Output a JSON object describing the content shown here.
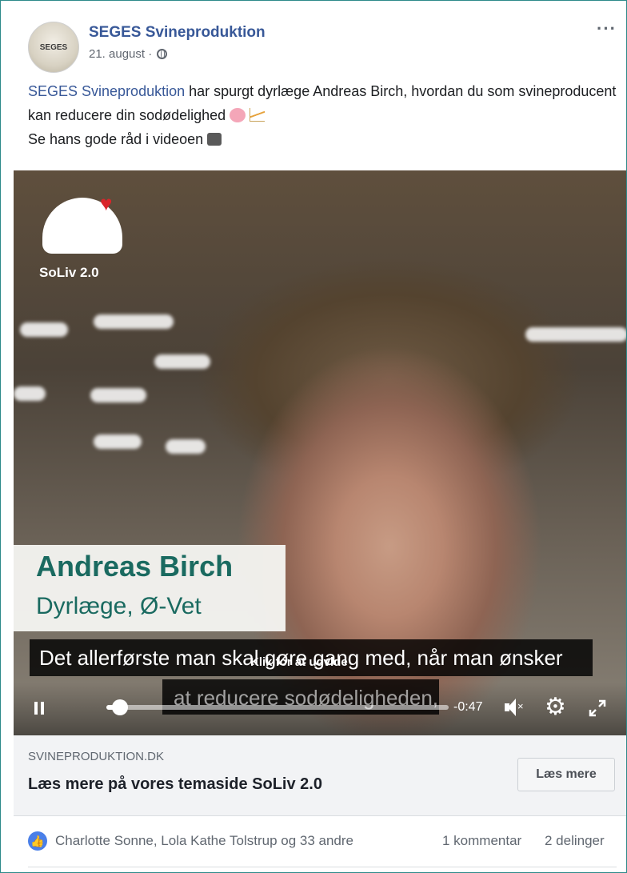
{
  "post": {
    "page_name": "SEGES Svineproduktion",
    "avatar_text": "SEGES",
    "date": "21. august · ",
    "text_link": "SEGES Svineproduktion",
    "text_rest": " har spurgt dyrlæge Andreas Birch, hvordan du som svineproducent kan reducere din sodødelighed ",
    "text_line2": "Se hans gode råd i videoen ",
    "more_label": "···"
  },
  "video": {
    "logo_text": "SoLiv 2.0",
    "person_name": "Andreas Birch",
    "person_role": "Dyrlæge, Ø-Vet",
    "subtitle_line1": "Det allerførste man skal gøre gang med, når man ønsker",
    "subtitle_line2": "at reducere sodødeligheden,",
    "tooltip": "Klik for at udvide",
    "time_remaining": "-0:47",
    "progress_fraction": 0.04
  },
  "link_preview": {
    "domain": "SVINEPRODUKTION.DK",
    "title": "Læs mere på vores temaside SoLiv 2.0",
    "button_label": "Læs mere"
  },
  "engagement": {
    "reactors": "Charlotte Sonne, Lola Kathe Tolstrup og 33 andre",
    "comments": "1 kommentar",
    "shares": "2 delinger"
  },
  "colors": {
    "link_blue": "#385898",
    "lower_third_green": "#1a6a60",
    "heart_red": "#d9252a",
    "card_border": "#2d8a8a"
  }
}
